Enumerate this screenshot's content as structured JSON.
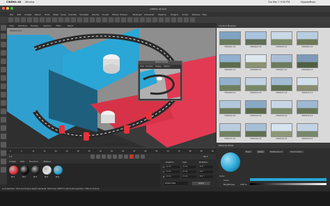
{
  "macbar": {
    "app_name": "CINEMA 4D",
    "menu_window": "Window",
    "clock": "Tue Mar 7 9:50 PM",
    "user": "HippieeRubz"
  },
  "window": {
    "title": "CINEMA 4D R18"
  },
  "menubar": {
    "items": [
      "File",
      "Edit",
      "Create",
      "Select",
      "Tools",
      "Mesh",
      "Snap",
      "Animate",
      "Simulate",
      "Render",
      "Sculpt",
      "Motion Tracker",
      "MoGraph",
      "Character",
      "Pipeline",
      "Plugins",
      "Script",
      "Window",
      "Help"
    ]
  },
  "viewport": {
    "menu": [
      "View",
      "Cameras",
      "Display",
      "Options",
      "Filter",
      "Panel"
    ],
    "label": "Perspective",
    "grid_spacing": "Grid Spacing : 100 cm"
  },
  "mini_render": {
    "title": "Picture Viewer",
    "menu": [
      "View",
      "Cameras",
      "Display",
      "Options"
    ]
  },
  "timeline": {
    "ticks": [
      "0",
      "5",
      "10",
      "15",
      "20",
      "25",
      "30",
      "35",
      "40",
      "45",
      "50",
      "55",
      "60",
      "65",
      "70",
      "75",
      "80",
      "85",
      "90"
    ],
    "current_frame": "0 F",
    "end_frame": "90 F"
  },
  "material_manager": {
    "menu": [
      "Create",
      "Edit",
      "Function",
      "Texture"
    ],
    "materials": [
      {
        "color": "#e8323a",
        "name": "Mat"
      },
      {
        "color": "#111111",
        "name": "Mat"
      },
      {
        "color": "#222222",
        "name": "Mat"
      },
      {
        "color": "#e6e6e6",
        "name": "Mat"
      },
      {
        "color": "#2aa7d6",
        "name": "Mat"
      }
    ]
  },
  "coords": {
    "headers": [
      "Position",
      "Size",
      "Rotation"
    ],
    "rows": [
      {
        "axis": "X",
        "pos": "0 cm",
        "size": "0 cm",
        "rot": "H 0 °"
      },
      {
        "axis": "Y",
        "pos": "0 cm",
        "size": "0 cm",
        "rot": "P 0 °"
      },
      {
        "axis": "Z",
        "pos": "0 cm",
        "size": "0 cm",
        "rot": "B 0 °"
      }
    ],
    "apply_button": "Apply",
    "mode": "Object (Rel)"
  },
  "hdri_browser": {
    "title": "Content Browser",
    "items": [
      {
        "label": "HDRI001.hdr",
        "colors": [
          "#7fa3c2",
          "#6a7a5a"
        ]
      },
      {
        "label": "HDRI002.hdr",
        "colors": [
          "#a9c3de",
          "#5f6f55"
        ]
      },
      {
        "label": "HDRI003.hdr",
        "colors": [
          "#c9d8e6",
          "#7c8c6a"
        ]
      },
      {
        "label": "HDRI004.hdr",
        "colors": [
          "#b8cde0",
          "#6d7a56"
        ]
      },
      {
        "label": "HDRI005.hdr",
        "colors": [
          "#8fb0cf",
          "#5c6c4c"
        ]
      },
      {
        "label": "HDRI006.hdr",
        "colors": [
          "#dfe7ef",
          "#8a9272"
        ]
      },
      {
        "label": "HDRI007.hdr",
        "colors": [
          "#aabfd6",
          "#6b7b5b"
        ]
      },
      {
        "label": "HDRI008.hdr",
        "colors": [
          "#7d9bb8",
          "#4f5f40"
        ]
      },
      {
        "label": "HDRI009.hdr",
        "colors": [
          "#93b1cc",
          "#6f7f5f"
        ]
      },
      {
        "label": "HDRI010.hdr",
        "colors": [
          "#c0d2e3",
          "#7a8868"
        ]
      },
      {
        "label": "HDRI011.hdr",
        "colors": [
          "#a2bcd4",
          "#5d6d4d"
        ]
      },
      {
        "label": "HDRI012.hdr",
        "colors": [
          "#d1dfeb",
          "#888c70"
        ]
      },
      {
        "label": "HDRI013.hdr",
        "colors": [
          "#b3c8dc",
          "#6a7a58"
        ]
      },
      {
        "label": "HDRI014.hdr",
        "colors": [
          "#8aa8c6",
          "#5a6a48"
        ]
      },
      {
        "label": "HDRI015.hdr",
        "colors": [
          "#c7d6e5",
          "#7b8b69"
        ]
      },
      {
        "label": "HDRI016.hdr",
        "colors": [
          "#9db8d1",
          "#667656"
        ]
      },
      {
        "label": "HDRI017.hdr",
        "colors": [
          "#b9cce0",
          "#708062"
        ]
      },
      {
        "label": "HDRI018.hdr",
        "colors": [
          "#a7bfd7",
          "#5f7051"
        ]
      },
      {
        "label": "HDRI019.hdr",
        "colors": [
          "#d6e2ee",
          "#8c9676"
        ]
      },
      {
        "label": "HDRI020.hdr",
        "colors": [
          "#c2d3e4",
          "#77876a"
        ]
      }
    ]
  },
  "attributes": {
    "title": "Material [Mat]",
    "tabs": [
      "Basic",
      "Color",
      "Reflectance",
      "Illumination"
    ],
    "section": "Color",
    "color_label": "Color",
    "brightness_label": "Brightness",
    "brightness_value": "100 %"
  },
  "status": {
    "text": "Live Selection: Click and drag to select elements. Hold down SHIFT to add to the selection, CTRL to remove."
  }
}
